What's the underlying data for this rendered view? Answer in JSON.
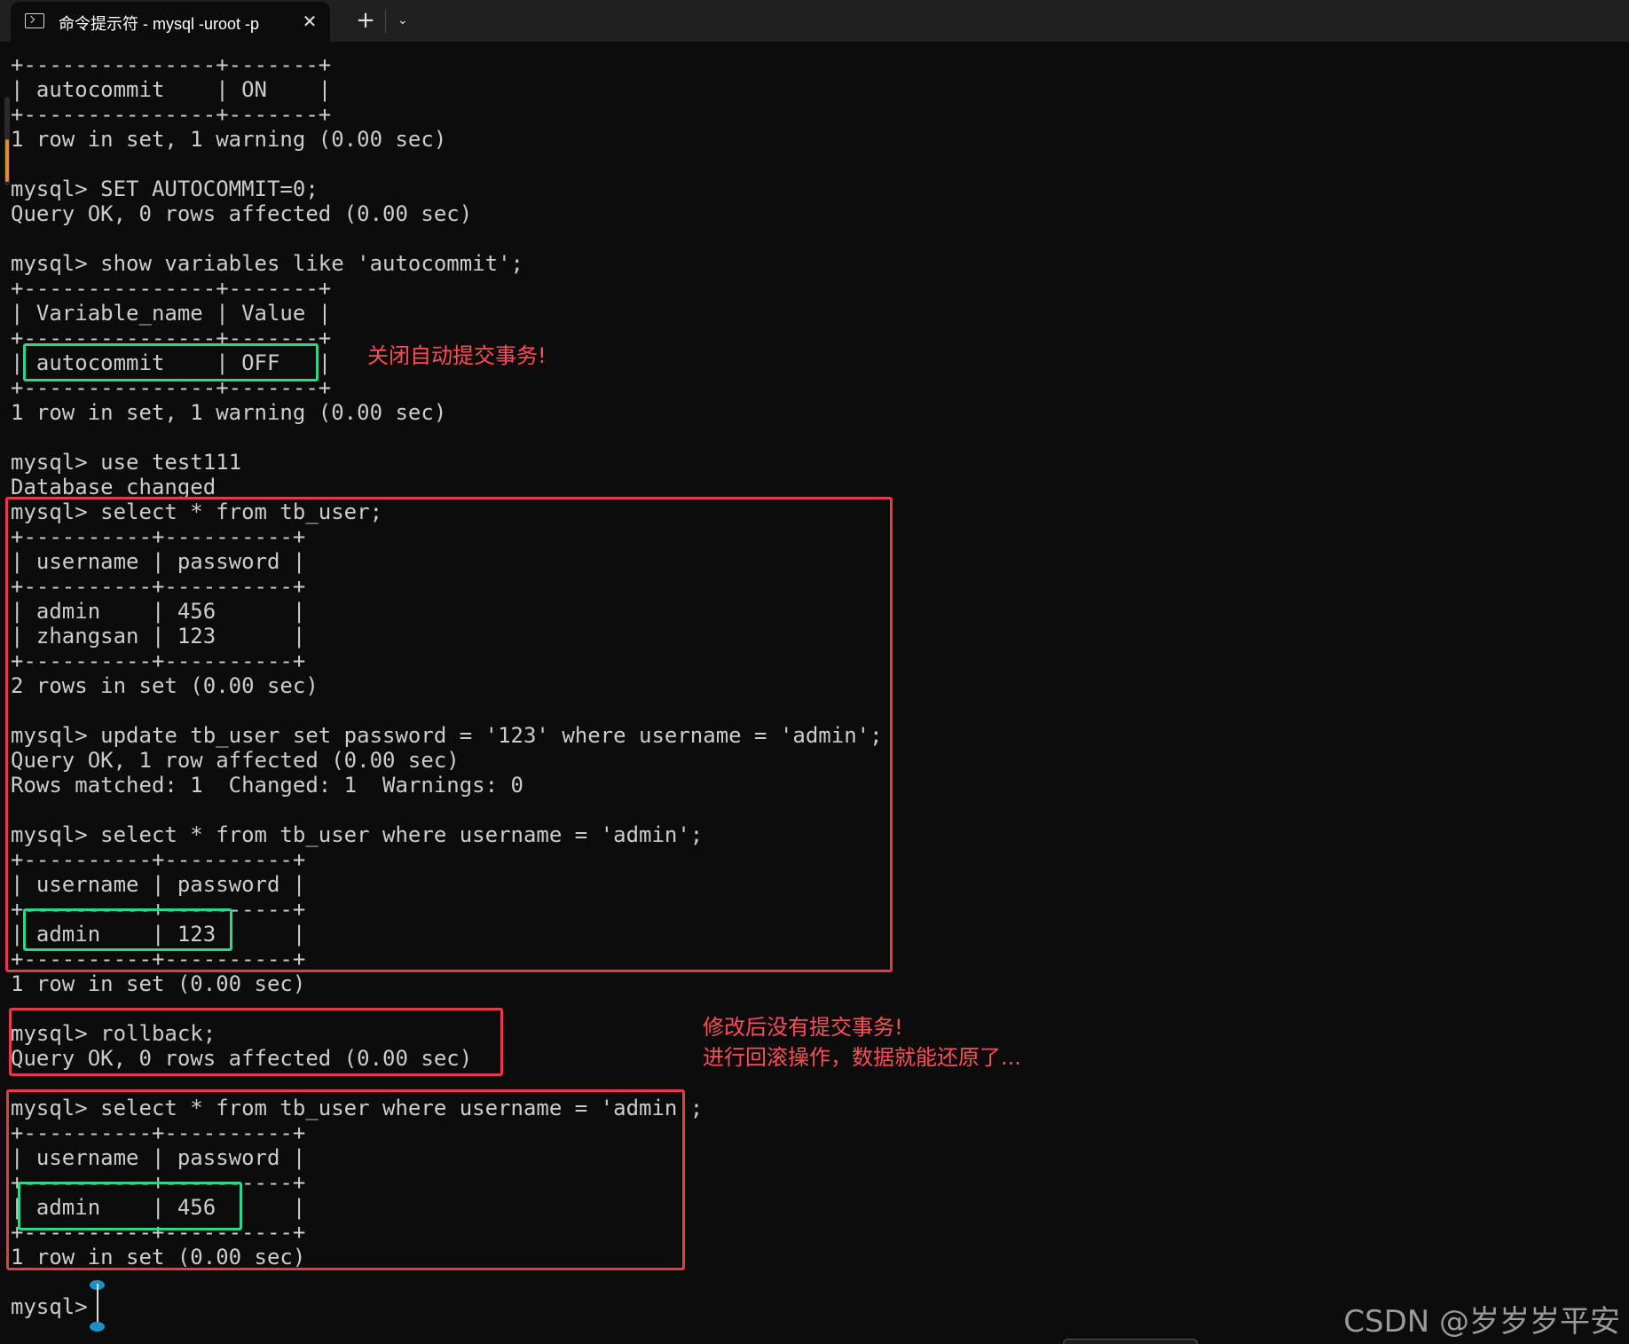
{
  "window": {
    "tab_title": "命令提示符 - mysql  -uroot -p",
    "tab_icon": "terminal-icon",
    "close_glyph": "✕",
    "new_tab_glyph": "+",
    "dropdown_glyph": "⌄"
  },
  "terminal": {
    "lines": [
      "+---------------+-------+",
      "| autocommit    | ON    |",
      "+---------------+-------+",
      "1 row in set, 1 warning (0.00 sec)",
      "",
      "mysql> SET AUTOCOMMIT=0;",
      "Query OK, 0 rows affected (0.00 sec)",
      "",
      "mysql> show variables like 'autocommit';",
      "+---------------+-------+",
      "| Variable_name | Value |",
      "+---------------+-------+",
      "| autocommit    | OFF   |",
      "+---------------+-------+",
      "1 row in set, 1 warning (0.00 sec)",
      "",
      "mysql> use test111",
      "Database changed",
      "mysql> select * from tb_user;",
      "+----------+----------+",
      "| username | password |",
      "+----------+----------+",
      "| admin    | 456      |",
      "| zhangsan | 123      |",
      "+----------+----------+",
      "2 rows in set (0.00 sec)",
      "",
      "mysql> update tb_user set password = '123' where username = 'admin';",
      "Query OK, 1 row affected (0.00 sec)",
      "Rows matched: 1  Changed: 1  Warnings: 0",
      "",
      "mysql> select * from tb_user where username = 'admin';",
      "+----------+----------+",
      "| username | password |",
      "+----------+----------+",
      "| admin    | 123      |",
      "+----------+----------+",
      "1 row in set (0.00 sec)",
      "",
      "mysql> rollback;",
      "Query OK, 0 rows affected (0.00 sec)",
      "",
      "mysql> select * from tb_user where username = 'admin';",
      "+----------+----------+",
      "| username | password |",
      "+----------+----------+",
      "| admin    | 456      |",
      "+----------+----------+",
      "1 row in set (0.00 sec)",
      "",
      "mysql> "
    ]
  },
  "annotations": {
    "autocommit_off": "关闭自动提交事务!",
    "rollback_line1": "修改后没有提交事务!",
    "rollback_line2": "进行回滚操作，数据就能还原了..."
  },
  "watermark": "CSDN @岁岁岁平安",
  "colors": {
    "background": "#0c0c0c",
    "text": "#cccccc",
    "highlight_red": "#e8384c",
    "highlight_green": "#2fd58a",
    "annotation_text": "#ff4d57"
  }
}
